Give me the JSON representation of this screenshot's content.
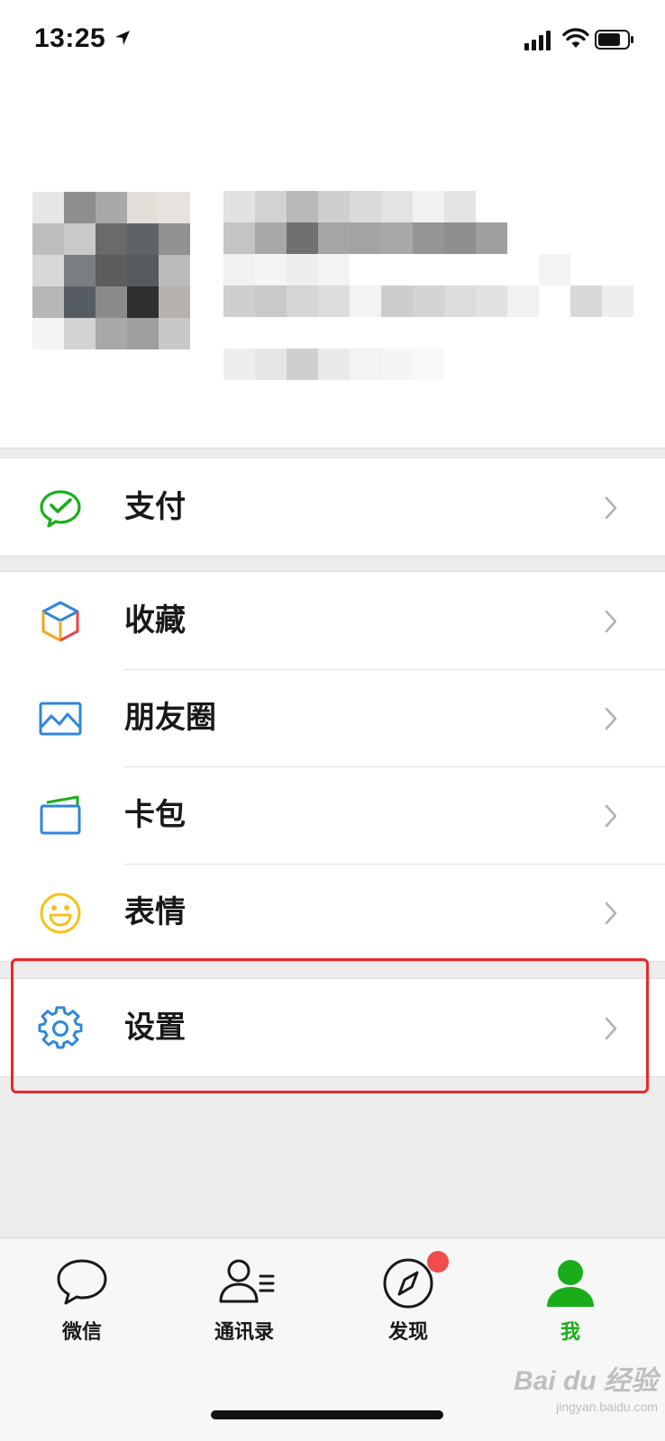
{
  "status_bar": {
    "time": "13:25"
  },
  "menu": {
    "groups": [
      {
        "items": [
          {
            "label": "支付",
            "icon": "wechat-pay-icon"
          }
        ]
      },
      {
        "items": [
          {
            "label": "收藏",
            "icon": "favorites-cube-icon"
          },
          {
            "label": "朋友圈",
            "icon": "moments-photo-icon"
          },
          {
            "label": "卡包",
            "icon": "card-wallet-icon"
          },
          {
            "label": "表情",
            "icon": "sticker-smiley-icon"
          }
        ]
      },
      {
        "items": [
          {
            "label": "设置",
            "icon": "settings-gear-icon"
          }
        ]
      }
    ]
  },
  "tabs": [
    {
      "label": "微信",
      "icon": "chat-bubble-icon",
      "active": false
    },
    {
      "label": "通讯录",
      "icon": "contacts-icon",
      "active": false
    },
    {
      "label": "发现",
      "icon": "discover-compass-icon",
      "active": false,
      "badge": true
    },
    {
      "label": "我",
      "icon": "me-person-icon",
      "active": true
    }
  ],
  "colors": {
    "accent_green": "#1aad19",
    "highlight_red": "#e8282a",
    "badge_red": "#f04c4c",
    "background": "#ededed"
  },
  "watermark": {
    "brand": "Bai du 经验",
    "url": "jingyan.baidu.com"
  }
}
